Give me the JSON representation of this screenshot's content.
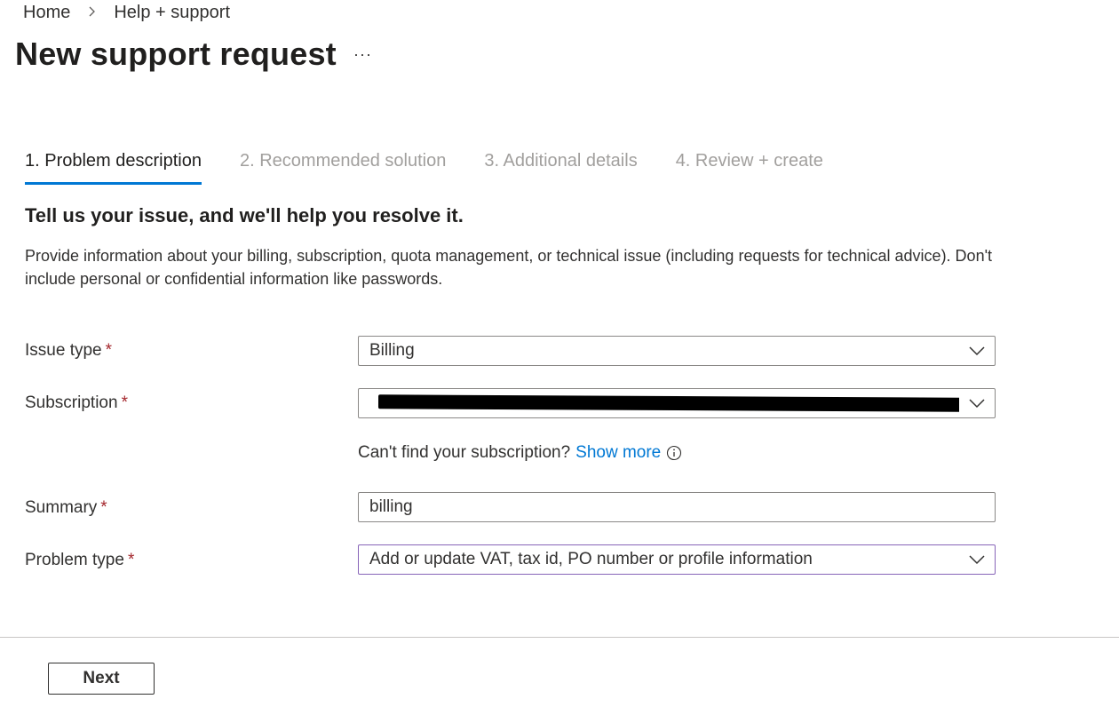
{
  "breadcrumb": {
    "home": "Home",
    "separator": "›",
    "current": "Help + support"
  },
  "page": {
    "title": "New support request",
    "more": "···"
  },
  "tabs": [
    {
      "label": "1. Problem description",
      "active": true
    },
    {
      "label": "2. Recommended solution",
      "active": false
    },
    {
      "label": "3. Additional details",
      "active": false
    },
    {
      "label": "4. Review + create",
      "active": false
    }
  ],
  "heading": "Tell us your issue, and we'll help you resolve it.",
  "description": "Provide information about your billing, subscription, quota management, or technical issue (including requests for technical advice). Don't include personal or confidential information like passwords.",
  "form": {
    "required_marker": "*",
    "issue_type": {
      "label": "Issue type",
      "value": "Billing"
    },
    "subscription": {
      "label": "Subscription",
      "value_redacted": true
    },
    "helper": {
      "text": "Can't find your subscription?",
      "link": "Show more",
      "icon": "info-icon"
    },
    "summary": {
      "label": "Summary",
      "value": "billing"
    },
    "problem_type": {
      "label": "Problem type",
      "value": "Add or update VAT, tax id, PO number or profile information"
    }
  },
  "footer": {
    "next_label": "Next"
  },
  "colors": {
    "accent": "#0078d4",
    "required": "#a4262c",
    "focus_border": "#8764b8"
  }
}
